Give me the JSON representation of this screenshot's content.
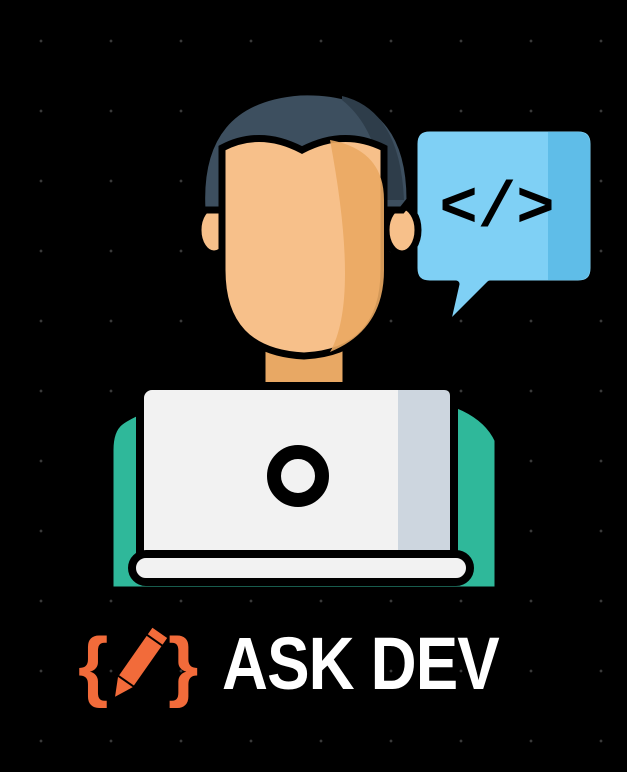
{
  "brand": {
    "name": "ASK DEV",
    "logo_icon": "code-braces-pencil-icon"
  },
  "illustration": {
    "subject_icon": "developer-at-laptop-icon",
    "speech_bubble_text": "</>"
  },
  "colors": {
    "background": "#000000",
    "accent_orange": "#f26b3a",
    "bubble_blue": "#7fd0f5",
    "hair": "#3d4f5f",
    "skin": "#f7c08a",
    "shirt": "#2fb89a",
    "laptop": "#f2f2f2"
  }
}
